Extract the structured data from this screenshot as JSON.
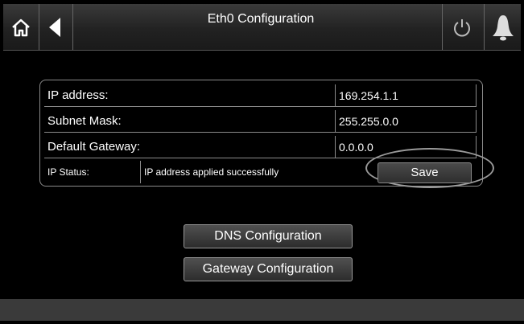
{
  "header": {
    "title": "Eth0 Configuration",
    "icons": [
      "home-icon",
      "back-arrow-icon",
      "power-icon",
      "alarm-bell-icon"
    ]
  },
  "config": {
    "rows": [
      {
        "label": "IP address:",
        "value": "169.254.1.1"
      },
      {
        "label": "Subnet Mask:",
        "value": "255.255.0.0"
      },
      {
        "label": "Default Gateway:",
        "value": "0.0.0.0"
      }
    ],
    "status_label": "IP Status:",
    "status_text": "IP address applied successfully",
    "save_label": "Save"
  },
  "buttons": {
    "dns_label": "DNS Configuration",
    "gateway_label": "Gateway Configuration"
  },
  "colors": {
    "background": "#000000",
    "header": "#2a2a2a",
    "border": "#8a8a8a",
    "text": "#ffffff"
  }
}
